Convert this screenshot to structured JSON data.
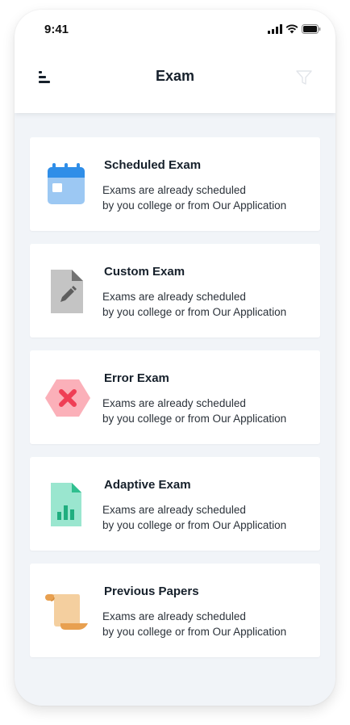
{
  "status_bar": {
    "time": "9:41",
    "icons": [
      "signal-icon",
      "wifi-icon",
      "battery-icon"
    ]
  },
  "header": {
    "title": "Exam",
    "menu_icon": "menu-icon",
    "filter_icon": "filter-icon"
  },
  "exams": [
    {
      "title": "Scheduled Exam",
      "desc_line1": "Exams are already scheduled",
      "desc_line2": "by you college or from Our Application",
      "icon": "calendar-icon",
      "color": "#2f8ee8"
    },
    {
      "title": "Custom Exam",
      "desc_line1": "Exams are already scheduled",
      "desc_line2": "by you college or from Our Application",
      "icon": "edit-document-icon",
      "color": "#8c8c8c"
    },
    {
      "title": "Error Exam",
      "desc_line1": "Exams are already scheduled",
      "desc_line2": "by you college or from Our Application",
      "icon": "error-hexagon-icon",
      "color": "#ef3e55"
    },
    {
      "title": "Adaptive Exam",
      "desc_line1": "Exams are already scheduled",
      "desc_line2": "by you college or from Our Application",
      "icon": "chart-document-icon",
      "color": "#2fbf8f"
    },
    {
      "title": "Previous Papers",
      "desc_line1": "Exams are already scheduled",
      "desc_line2": "by you college or from Our Application",
      "icon": "scroll-icon",
      "color": "#e8a050"
    }
  ]
}
